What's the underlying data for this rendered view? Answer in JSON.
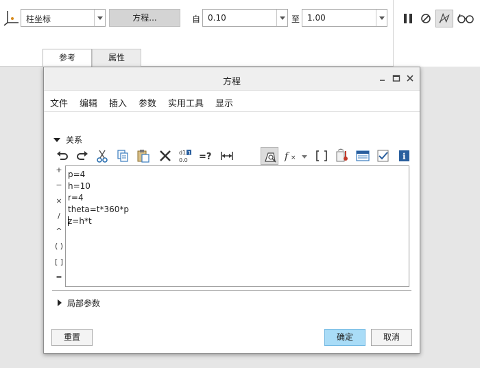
{
  "ribbon": {
    "coord_type": "柱坐标",
    "equation_button": "方程...",
    "from_label": "自",
    "from_value": "0.10",
    "to_label": "至",
    "to_value": "1.00",
    "tabs": [
      {
        "label": "参考"
      },
      {
        "label": "属性"
      }
    ]
  },
  "dialog": {
    "title": "方程",
    "menu": [
      "文件",
      "编辑",
      "插入",
      "参数",
      "实用工具",
      "显示"
    ],
    "relations_label": "关系",
    "operators": [
      "+",
      "−",
      "×",
      "/",
      "^",
      "( )",
      "[ ]",
      "="
    ],
    "code_lines": [
      "p=4",
      "h=10",
      "r=4",
      "theta=t*360*p",
      "z=h*t"
    ],
    "local_params_label": "局部参数",
    "buttons": {
      "reset": "重置",
      "ok": "确定",
      "cancel": "取消"
    }
  },
  "colors": {
    "ok_button": "#a9dcf7",
    "pinned_tool": "#dcdcdc",
    "equation_button": "#d4d4d4"
  }
}
